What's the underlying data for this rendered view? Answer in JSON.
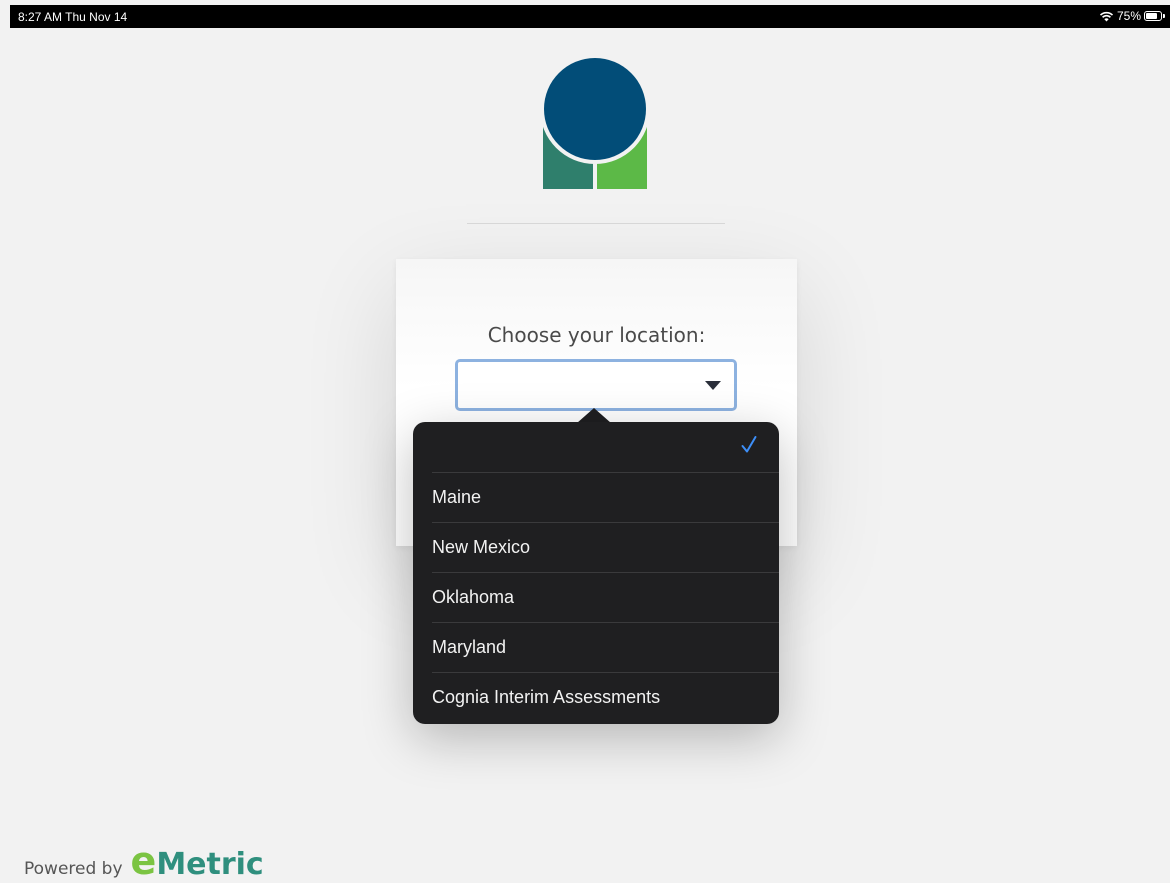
{
  "status_bar": {
    "time_date": "8:27 AM  Thu Nov 14",
    "battery_percent": "75%",
    "battery_level": 0.75,
    "wifi_icon": "wifi-icon",
    "battery_icon": "battery-icon"
  },
  "logo": {
    "circle_color": "#024d78",
    "left_block_color": "#2f7f6c",
    "right_block_color": "#5cb947"
  },
  "location_card": {
    "title": "Choose your location:",
    "selected_value": "",
    "caret_icon": "caret-down-icon"
  },
  "dropdown": {
    "check_icon": "checkmark-icon",
    "options": [
      {
        "label": "",
        "selected": true
      },
      {
        "label": "Maine",
        "selected": false
      },
      {
        "label": "New Mexico",
        "selected": false
      },
      {
        "label": "Oklahoma",
        "selected": false
      },
      {
        "label": "Maryland",
        "selected": false
      },
      {
        "label": "Cognia Interim Assessments",
        "selected": false
      }
    ]
  },
  "footer": {
    "powered_by": "Powered by",
    "brand_e": "e",
    "brand_rest": "Metric",
    "brand_e_color": "#7bc442",
    "brand_rest_color": "#2f8f7e"
  }
}
